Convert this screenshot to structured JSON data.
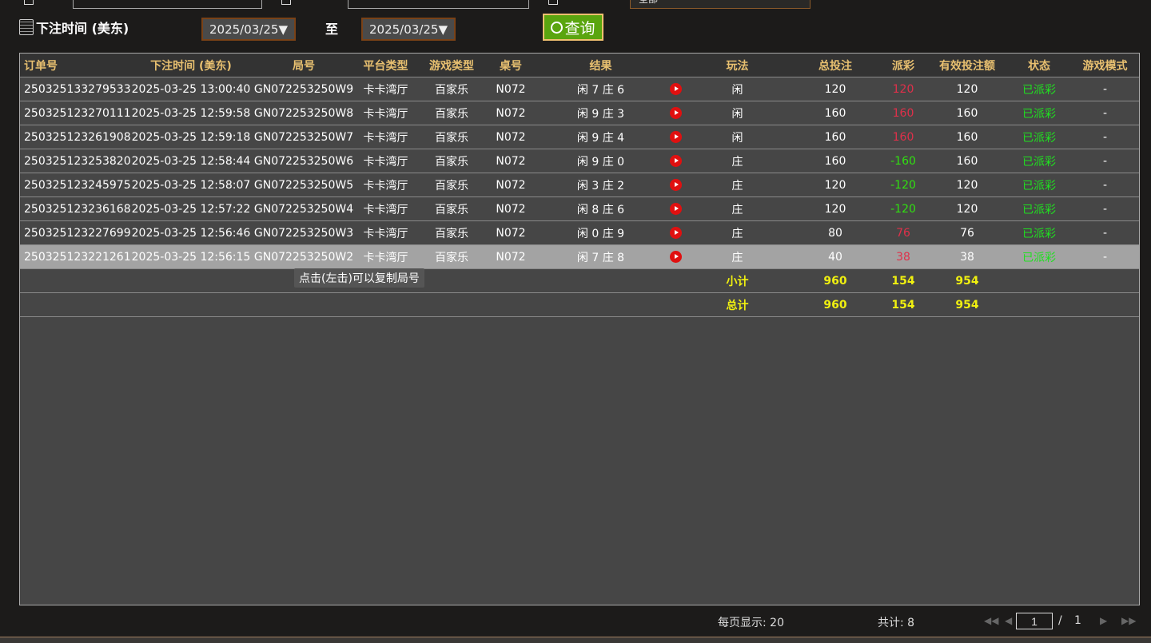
{
  "filters": {
    "top_select": "全部",
    "bet_time_label": "下注时间 (美东)",
    "date_from": "2025/03/25▼",
    "to_label": "至",
    "date_to": "2025/03/25▼",
    "query_label": "查询"
  },
  "columns": [
    "订单号",
    "下注时间 (美东)",
    "局号",
    "平台类型",
    "游戏类型",
    "桌号",
    "结果",
    "",
    "玩法",
    "总投注",
    "派彩",
    "有效投注额",
    "状态",
    "游戏模式"
  ],
  "rows": [
    [
      "250325133279533",
      "2025-03-25 13:00:40",
      "GN072253250W9",
      "卡卡湾厅",
      "百家乐",
      "N072",
      "闲 7 庄 6",
      "",
      "闲",
      "120",
      "120",
      "120",
      "已派彩",
      "-"
    ],
    [
      "250325123270111",
      "2025-03-25 12:59:58",
      "GN072253250W8",
      "卡卡湾厅",
      "百家乐",
      "N072",
      "闲 9 庄 3",
      "",
      "闲",
      "160",
      "160",
      "160",
      "已派彩",
      "-"
    ],
    [
      "250325123261908",
      "2025-03-25 12:59:18",
      "GN072253250W7",
      "卡卡湾厅",
      "百家乐",
      "N072",
      "闲 9 庄 4",
      "",
      "闲",
      "160",
      "160",
      "160",
      "已派彩",
      "-"
    ],
    [
      "250325123253820",
      "2025-03-25 12:58:44",
      "GN072253250W6",
      "卡卡湾厅",
      "百家乐",
      "N072",
      "闲 9 庄 0",
      "",
      "庄",
      "160",
      "-160",
      "160",
      "已派彩",
      "-"
    ],
    [
      "250325123245975",
      "2025-03-25 12:58:07",
      "GN072253250W5",
      "卡卡湾厅",
      "百家乐",
      "N072",
      "闲 3 庄 2",
      "",
      "庄",
      "120",
      "-120",
      "120",
      "已派彩",
      "-"
    ],
    [
      "250325123236168",
      "2025-03-25 12:57:22",
      "GN072253250W4",
      "卡卡湾厅",
      "百家乐",
      "N072",
      "闲 8 庄 6",
      "",
      "庄",
      "120",
      "-120",
      "120",
      "已派彩",
      "-"
    ],
    [
      "250325123227699",
      "2025-03-25 12:56:46",
      "GN072253250W3",
      "卡卡湾厅",
      "百家乐",
      "N072",
      "闲 0 庄 9",
      "",
      "庄",
      "80",
      "76",
      "76",
      "已派彩",
      "-"
    ],
    [
      "250325123221261",
      "2025-03-25 12:56:15",
      "GN072253250W2",
      "卡卡湾厅",
      "百家乐",
      "N072",
      "闲 7 庄 8",
      "",
      "庄",
      "40",
      "38",
      "38",
      "已派彩",
      "-"
    ]
  ],
  "subtotal": {
    "label": "小计",
    "total": "960",
    "payout": "154",
    "valid": "954"
  },
  "grandtotal": {
    "label": "总计",
    "total": "960",
    "payout": "154",
    "valid": "954"
  },
  "tooltip": "点击(左击)可以复制局号",
  "footer": {
    "per_page": "每页显示: 20",
    "count": "共计: 8",
    "page": "1",
    "sep": "/",
    "pages": "1"
  },
  "colors": {
    "win": "#e0304a",
    "loss": "#30e010",
    "status": "#20e020",
    "header": "#e8c070",
    "sum": "#f0f010"
  }
}
